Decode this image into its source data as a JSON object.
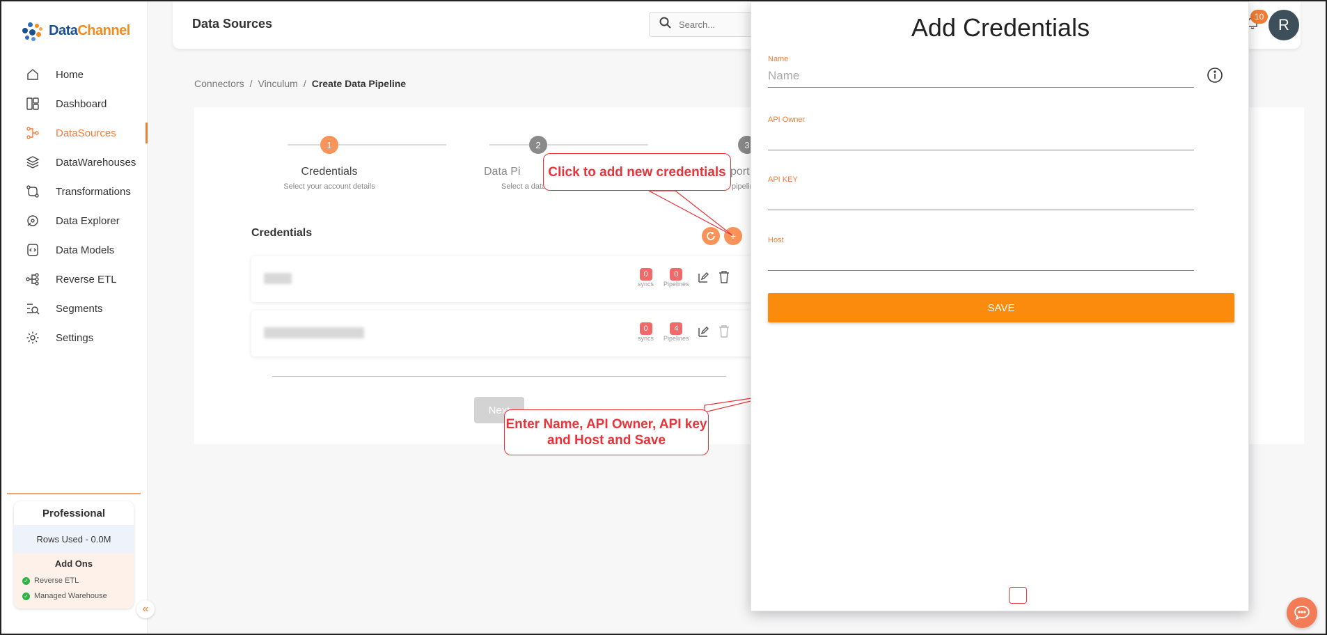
{
  "app": {
    "brand_data": "Data",
    "brand_channel": "Channel"
  },
  "sidebar": {
    "items": [
      {
        "label": "Home",
        "icon": "home-icon"
      },
      {
        "label": "Dashboard",
        "icon": "dashboard-icon"
      },
      {
        "label": "DataSources",
        "icon": "datasources-icon",
        "active": true
      },
      {
        "label": "DataWarehouses",
        "icon": "layers-icon"
      },
      {
        "label": "Transformations",
        "icon": "transform-icon"
      },
      {
        "label": "Data Explorer",
        "icon": "explorer-icon"
      },
      {
        "label": "Data Models",
        "icon": "models-icon"
      },
      {
        "label": "Reverse ETL",
        "icon": "reverse-etl-icon"
      },
      {
        "label": "Segments",
        "icon": "segments-icon"
      },
      {
        "label": "Settings",
        "icon": "gear-icon"
      }
    ],
    "plan": {
      "title": "Professional",
      "rows_used": "Rows Used - 0.0M",
      "addons_title": "Add Ons",
      "addons": [
        "Reverse ETL",
        "Managed Warehouse"
      ]
    },
    "collapse_glyph": "«"
  },
  "header": {
    "title": "Data Sources",
    "search_placeholder": "Search...",
    "notification_count": "10",
    "avatar_initial": "R"
  },
  "breadcrumb": {
    "items": [
      "Connectors",
      "Vinculum"
    ],
    "separator": "/",
    "current": "Create Data Pipeline"
  },
  "stepper": {
    "steps": [
      {
        "number": "1",
        "label": "Credentials",
        "sub": "Select your account details"
      },
      {
        "number": "2",
        "label": "Data Pi",
        "sub": "Select a data"
      },
      {
        "number": "3",
        "label": "port",
        "sub": "pipelin"
      }
    ]
  },
  "credentials": {
    "header": "Credentials",
    "rows": [
      {
        "syncs": "0",
        "pipelines": "0"
      },
      {
        "syncs": "0",
        "pipelines": "4"
      }
    ],
    "syncs_label": "syncs",
    "pipelines_label": "Pipelines",
    "next_label": "Next"
  },
  "annotations": {
    "add_callout": "Click to add new credentials",
    "save_callout": "Enter Name, API Owner, API key and Host and Save"
  },
  "drawer": {
    "title": "Add Credentials",
    "fields": [
      {
        "label": "Name",
        "placeholder": "Name",
        "value": ""
      },
      {
        "label": "API Owner",
        "placeholder": "",
        "value": ""
      },
      {
        "label": "API KEY",
        "placeholder": "",
        "value": ""
      },
      {
        "label": "Host",
        "placeholder": "",
        "value": ""
      }
    ],
    "save_label": "SAVE"
  },
  "colors": {
    "accent": "#f27c37",
    "save": "#fb8b0c",
    "annotation": "#e8333a",
    "brand_blue": "#1b4f8f"
  }
}
